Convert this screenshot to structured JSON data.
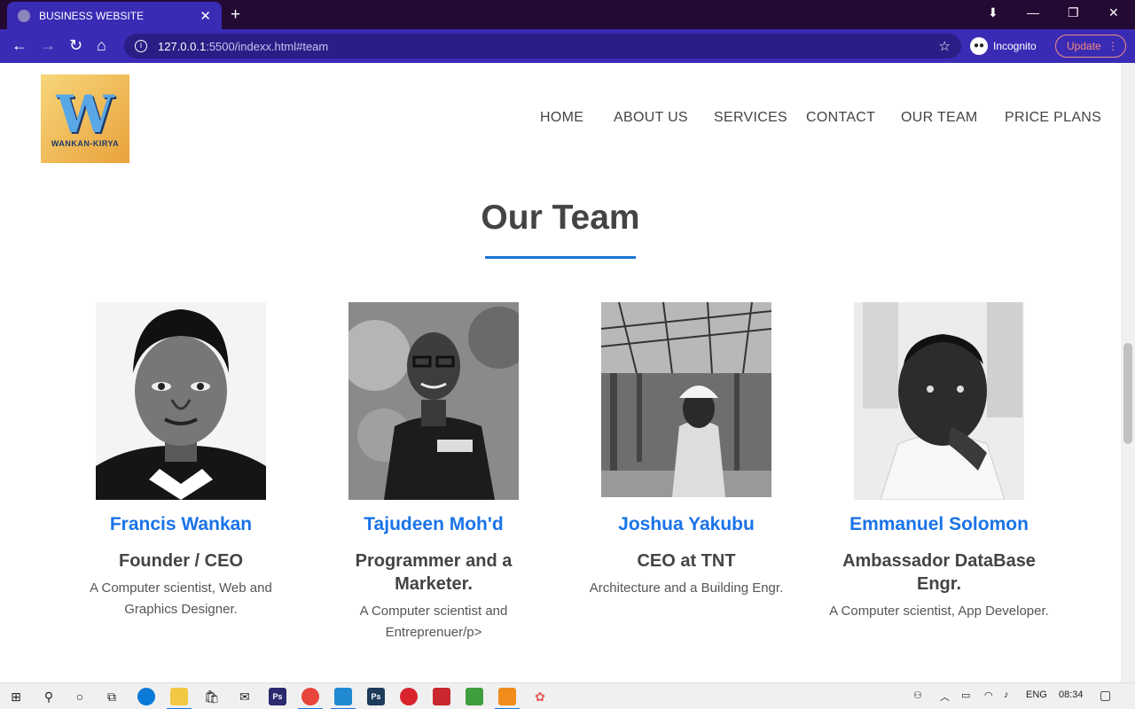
{
  "browser": {
    "tab_title": "BUSINESS WEBSITE",
    "url_host": "127.0.0.1",
    "url_rest": ":5500/indexx.html#team",
    "profile_label": "Incognito",
    "update_label": "Update"
  },
  "site": {
    "logo_letter": "W",
    "logo_text": "WANKAN-KIRYA",
    "nav": [
      "HOME",
      "ABOUT US",
      "SERVICES",
      "CONTACT",
      "OUR TEAM",
      "PRICE PLANS"
    ]
  },
  "team": {
    "title": "Our Team",
    "members": [
      {
        "name": "Francis Wankan",
        "role": "Founder / CEO",
        "desc": "A Computer scientist, Web and Graphics Designer."
      },
      {
        "name": "Tajudeen Moh'd",
        "role": "Programmer and a Marketer.",
        "desc": "A Computer scientist and Entreprenuer/p>"
      },
      {
        "name": "Joshua Yakubu",
        "role": "CEO at TNT",
        "desc": "Architecture and a Building Engr."
      },
      {
        "name": "Emmanuel Solomon",
        "role": "Ambassador DataBase Engr.",
        "desc": "A Computer scientist, App Developer."
      }
    ]
  },
  "taskbar": {
    "language": "ENG",
    "time": "08:34"
  }
}
